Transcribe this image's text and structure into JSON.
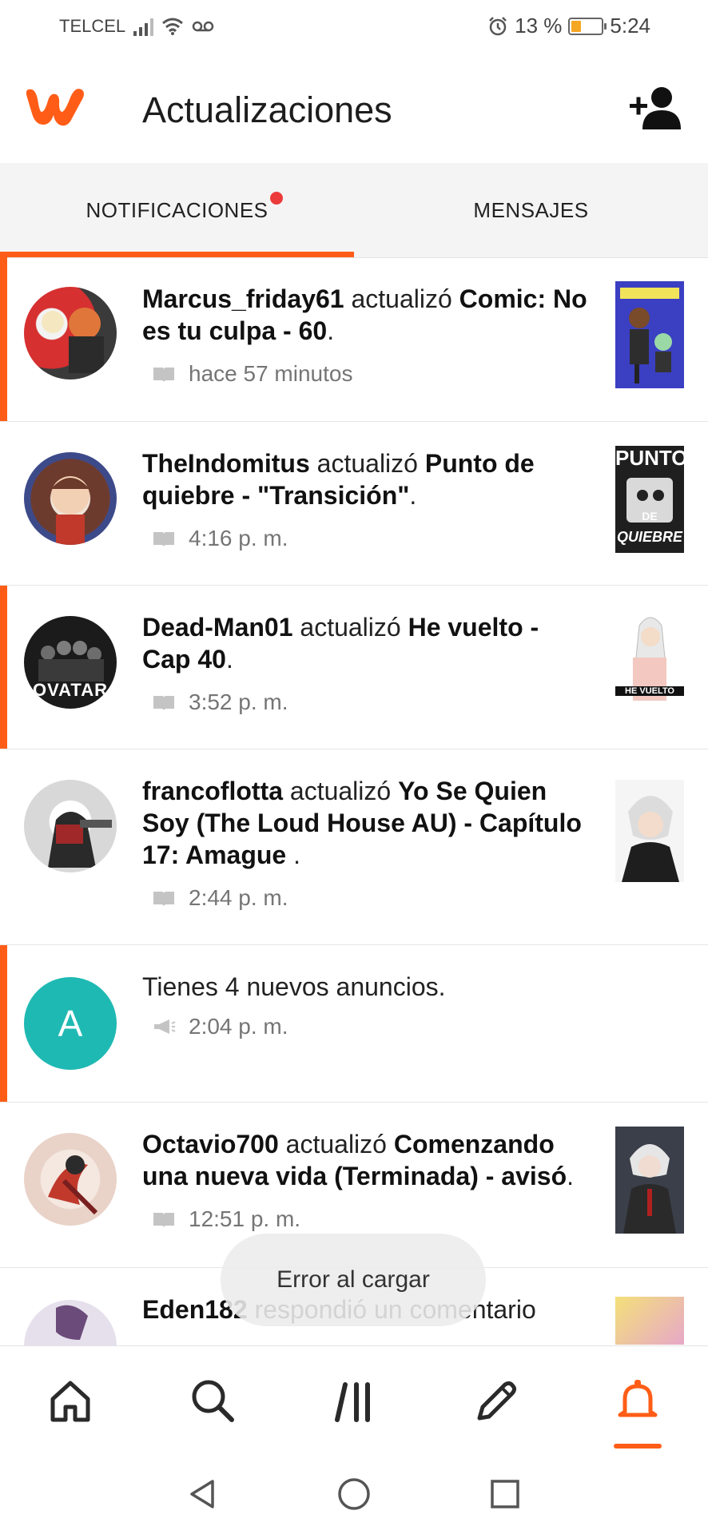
{
  "status_bar": {
    "carrier": "TELCEL",
    "battery_pct_text": "13 %",
    "battery_level": 0.13,
    "time": "5:24"
  },
  "header": {
    "title": "Actualizaciones",
    "brand_color": "#ff5d17"
  },
  "tabs": [
    {
      "label": "NOTIFICACIONES",
      "active": true,
      "has_dot": true
    },
    {
      "label": "MENSAJES",
      "active": false,
      "has_dot": false
    }
  ],
  "notifications": [
    {
      "user": "Marcus_friday61",
      "action": "actualizó",
      "target": "Comic: No es tu culpa - 60",
      "suffix": ".",
      "time": "hace 57 minutos",
      "icon": "book-icon",
      "unread": true
    },
    {
      "user": "TheIndomitus",
      "action": "actualizó",
      "target": "Punto de quiebre - \"Transición\"",
      "suffix": ".",
      "time": "4:16 p. m.",
      "icon": "book-icon",
      "unread": false,
      "cover_text": [
        "PUNTO",
        "DE",
        "QUIEBRE"
      ]
    },
    {
      "user": "Dead-Man01",
      "action": "actualizó",
      "target": "He vuelto - Cap 40",
      "suffix": ".",
      "time": "3:52 p. m.",
      "icon": "book-icon",
      "unread": true,
      "avatar_text": "OVATAR",
      "cover_text": [
        "HE VUELTO"
      ]
    },
    {
      "user": "francoflotta",
      "action": "actualizó",
      "target": "Yo Se Quien Soy (The Loud House AU) - Capítulo 17: Amague",
      "suffix": " .",
      "time": "2:44 p. m.",
      "icon": "book-icon",
      "unread": false
    },
    {
      "message": "Tienes 4 nuevos anuncios.",
      "time": "2:04 p. m.",
      "icon": "megaphone-icon",
      "unread": true,
      "avatar_letter": "A"
    },
    {
      "user": "Octavio700",
      "action": "actualizó",
      "target": "Comenzando una nueva vida (Terminada) - avisó",
      "suffix": ".",
      "time": "12:51 p. m.",
      "icon": "book-icon",
      "unread": false
    },
    {
      "user": "Eden182",
      "action": "respondió un comentario",
      "target": "",
      "suffix": "",
      "unread": false
    }
  ],
  "toast": {
    "text": "Error al cargar"
  },
  "bottom_nav": [
    {
      "name": "home-icon",
      "active": false
    },
    {
      "name": "search-icon",
      "active": false
    },
    {
      "name": "library-icon",
      "active": false
    },
    {
      "name": "write-icon",
      "active": false
    },
    {
      "name": "bell-icon",
      "active": true
    }
  ]
}
